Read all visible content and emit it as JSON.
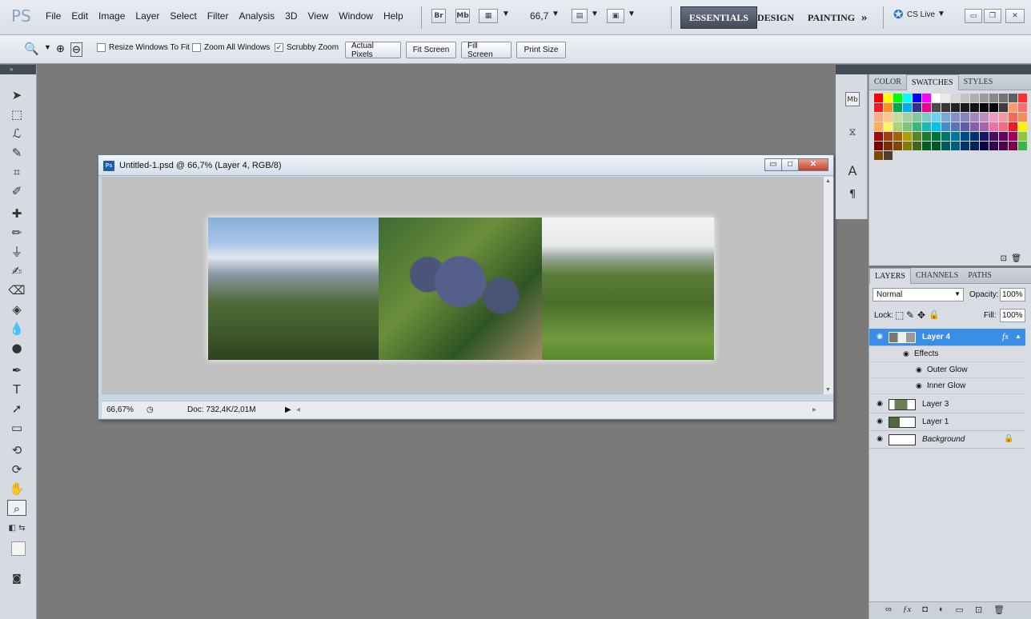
{
  "app": {
    "logo": "PS",
    "menus": [
      "File",
      "Edit",
      "Image",
      "Layer",
      "Select",
      "Filter",
      "Analysis",
      "3D",
      "View",
      "Window",
      "Help"
    ],
    "bridge_label": "Br",
    "minibridge_label": "Mb",
    "zoom_value": "66,7",
    "workspaces": [
      "ESSENTIALS",
      "DESIGN",
      "PAINTING"
    ],
    "more_label": "»",
    "cslive_label": "CS Live"
  },
  "options": {
    "resize_windows": "Resize Windows To Fit",
    "zoom_all": "Zoom All Windows",
    "scrubby": "Scrubby Zoom",
    "scrubby_checked": "✓",
    "actual_pixels": "Actual Pixels",
    "fit_screen": "Fit Screen",
    "fill_screen": "Fill Screen",
    "print_size": "Print Size"
  },
  "document": {
    "ps_icon": "Ps",
    "title": "Untitled-1.psd @ 66,7% (Layer 4, RGB/8)",
    "zoom": "66,67%",
    "doc_info": "Doc: 732,4K/2,01M"
  },
  "swatches_panel": {
    "tabs": [
      "COLOR",
      "SWATCHES",
      "STYLES"
    ],
    "active_tab": 1,
    "colors": [
      "#ff0000",
      "#ffff00",
      "#00ff00",
      "#00ffff",
      "#0000ff",
      "#ff00ff",
      "#ffffff",
      "#ebebeb",
      "#d7d7d7",
      "#c3c3c3",
      "#afafaf",
      "#9b9b9b",
      "#878787",
      "#737373",
      "#5f5f5f",
      "#ff3030",
      "#ed1c24",
      "#f7941d",
      "#00a651",
      "#00aeef",
      "#2e3192",
      "#ec008c",
      "#4b4b4b",
      "#373737",
      "#232323",
      "#1a1a1a",
      "#111111",
      "#080808",
      "#000000",
      "#3c3c3c",
      "#ff9b6a",
      "#ff6e6e",
      "#f9ad81",
      "#fdc68a",
      "#c4df9b",
      "#a3d39c",
      "#82ca9c",
      "#7accc8",
      "#6dcff6",
      "#7da7d9",
      "#8393ca",
      "#8882be",
      "#a187be",
      "#bc8dbf",
      "#f49ac2",
      "#f6989d",
      "#f26c4f",
      "#f68e55",
      "#fbaf5c",
      "#fff468",
      "#acd372",
      "#7cc576",
      "#3bb878",
      "#1abbb4",
      "#00bff3",
      "#438ccb",
      "#5574b9",
      "#605ca8",
      "#855fa8",
      "#a763a8",
      "#f06eaa",
      "#f26d7d",
      "#ed1c24",
      "#fff200",
      "#9e0b0f",
      "#a0410d",
      "#a36209",
      "#aba000",
      "#598527",
      "#1a7b30",
      "#007236",
      "#00746b",
      "#0076a3",
      "#004b80",
      "#003471",
      "#1b1464",
      "#440e62",
      "#630460",
      "#9e005d",
      "#8dc63f",
      "#790000",
      "#7b2e00",
      "#7d4900",
      "#827b00",
      "#406618",
      "#005e20",
      "#005826",
      "#005952",
      "#005b7f",
      "#003663",
      "#002157",
      "#0d004c",
      "#32004b",
      "#4b0049",
      "#7b0046",
      "#39b54a",
      "#7c4900",
      "#533d2e"
    ]
  },
  "layers_panel": {
    "tabs": [
      "LAYERS",
      "CHANNELS",
      "PATHS"
    ],
    "active_tab": 0,
    "blend_mode": "Normal",
    "opacity_label": "Opacity:",
    "opacity_value": "100%",
    "lock_label": "Lock:",
    "fill_label": "Fill:",
    "fill_value": "100%",
    "fx_label": "fx",
    "layers": [
      {
        "name": "Layer 4",
        "selected": true
      },
      {
        "name": "Layer 3",
        "selected": false
      },
      {
        "name": "Layer 1",
        "selected": false
      },
      {
        "name": "Background",
        "selected": false
      }
    ],
    "effects_label": "Effects",
    "effect_items": [
      "Outer Glow",
      "Inner Glow"
    ]
  },
  "colors": {
    "selection_blue": "#3a8ee6",
    "workspace_bg": "#7a7a7a"
  }
}
